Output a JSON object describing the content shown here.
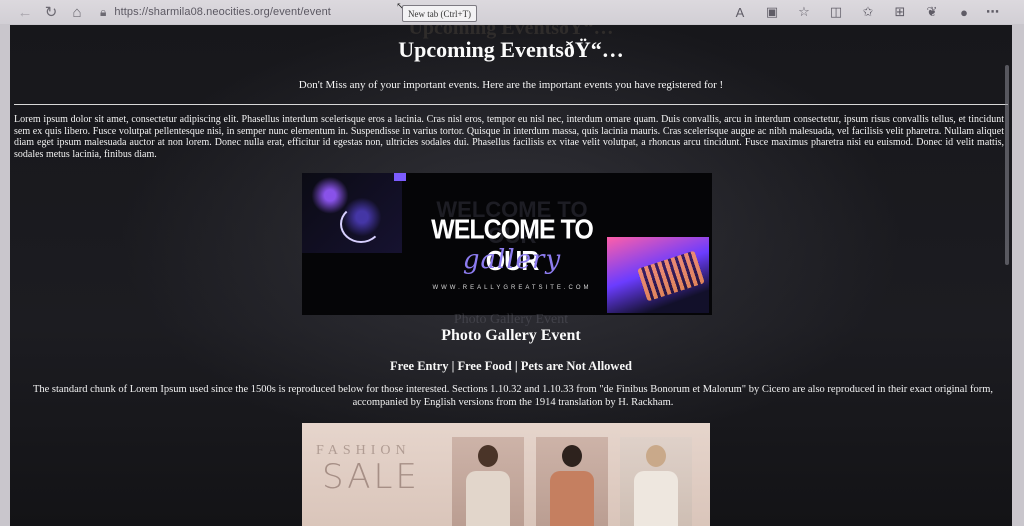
{
  "browser": {
    "url": "https://sharmila08.neocities.org/event/event",
    "tooltip": "New tab (Ctrl+T)"
  },
  "icons": {
    "back": "←",
    "refresh": "↻",
    "home": "⌂",
    "lock": "🔒",
    "read_aloud": "A",
    "immersive_reader": "▣",
    "favorite": "☆",
    "split_screen": "◫",
    "favorites": "✩",
    "collections": "⊞",
    "copilot": "❦",
    "profile": "●",
    "menu": "⋯"
  },
  "page": {
    "ghost_title": "Upcoming EventsðŸ“…",
    "title": "Upcoming EventsðŸ“…",
    "subtitle": "Don't Miss any of your important events. Here are the important events you have registered for !",
    "intro": "Lorem ipsum dolor sit amet, consectetur adipiscing elit. Phasellus interdum scelerisque eros a lacinia. Cras nisl eros, tempor eu nisl nec, interdum ornare quam. Duis convallis, arcu in interdum consectetur, ipsum risus convallis tellus, et tincidunt sem ex quis libero. Fusce volutpat pellentesque nisi, in semper nunc elementum in. Suspendisse in varius tortor. Quisque in interdum massa, quis lacinia mauris. Cras scelerisque augue ac nibh malesuada, vel facilisis velit pharetra. Nullam aliquet diam eget ipsum malesuada auctor at non lorem. Donec nulla erat, efficitur id egestas non, ultricies sodales dui. Phasellus facilisis ex vitae velit volutpat, a rhoncus arcu tincidunt. Fusce maximus pharetra nisi eu euismod. Donec id velit mattis, sodales metus lacinia, finibus diam."
  },
  "gallery_banner": {
    "welcome": "WELCOME TO OUR",
    "gallery": "gallery",
    "site": "WWW.REALLYGREATSITE.COM"
  },
  "event": {
    "ghost_title": "Photo Gallery Event",
    "title": "Photo Gallery Event",
    "info": "Free Entry | Free Food | Pets are Not Allowed",
    "description": "The standard chunk of Lorem Ipsum used since the 1500s is reproduced below for those interested. Sections 1.10.32 and 1.10.33 from \"de Finibus Bonorum et Malorum\" by Cicero are also reproduced in their exact original form, accompanied by English versions from the 1914 translation by H. Rackham."
  },
  "fashion_banner": {
    "fashion": "FASHION",
    "sale": "SALE"
  }
}
